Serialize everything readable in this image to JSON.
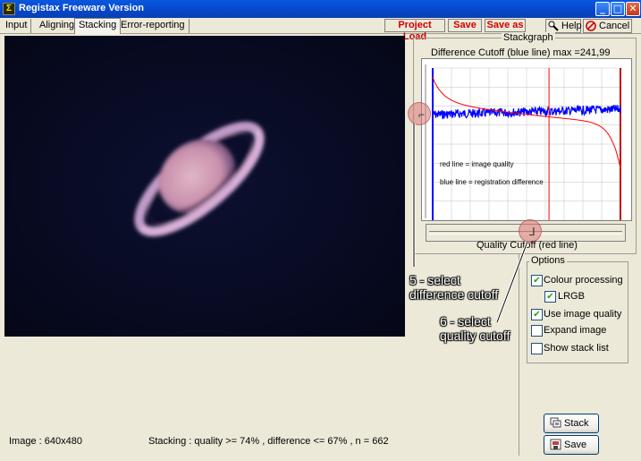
{
  "window": {
    "title": "Registax Freeware Version",
    "app_icon_glyph": "Σ"
  },
  "title_buttons": {
    "minimize": "_",
    "maximize": "□",
    "close": "✕"
  },
  "tabs": [
    {
      "label": "Input",
      "active": false
    },
    {
      "label": "Aligning",
      "active": false
    },
    {
      "label": "Stacking",
      "active": true
    },
    {
      "label": "Error-reporting",
      "active": false
    }
  ],
  "actions": {
    "project_load": "Project Load",
    "save": "Save",
    "save_as": "Save as"
  },
  "sys_buttons": {
    "help": "Help",
    "cancel": "Cancel"
  },
  "stackgraph": {
    "group_title": "Stackgraph",
    "chart_title": "Difference Cutoff (blue line) max =241,99",
    "legend_red": "red  line = image quality",
    "legend_blue": "blue line = registration difference",
    "xlabel": "Quality Cutoff (red line)",
    "colors": {
      "quality": "#ff0000",
      "difference": "#0000ff",
      "cutoff": "#ff0000",
      "grid": "#c0c0c0"
    }
  },
  "options": {
    "group_title": "Options",
    "items": [
      {
        "label": "Colour processing",
        "checked": true
      },
      {
        "label": "LRGB",
        "checked": true
      },
      {
        "label": "Use image quality",
        "checked": true
      },
      {
        "label": "Expand image",
        "checked": false
      },
      {
        "label": "Show stack list",
        "checked": false
      }
    ]
  },
  "buttons": {
    "stack": "Stack",
    "save": "Save"
  },
  "status": {
    "image": "Image : 640x480",
    "stacking": "Stacking : quality >= 74% , difference <= 67% , n = 662"
  },
  "annotations": {
    "step5_line1": "5 - select",
    "step5_line2": "difference cutoff",
    "step6_line1": "6 - select",
    "step6_line2": "quality cutoff"
  },
  "sliders": {
    "difference_cutoff_percent": 67,
    "quality_cutoff_percent": 74
  }
}
